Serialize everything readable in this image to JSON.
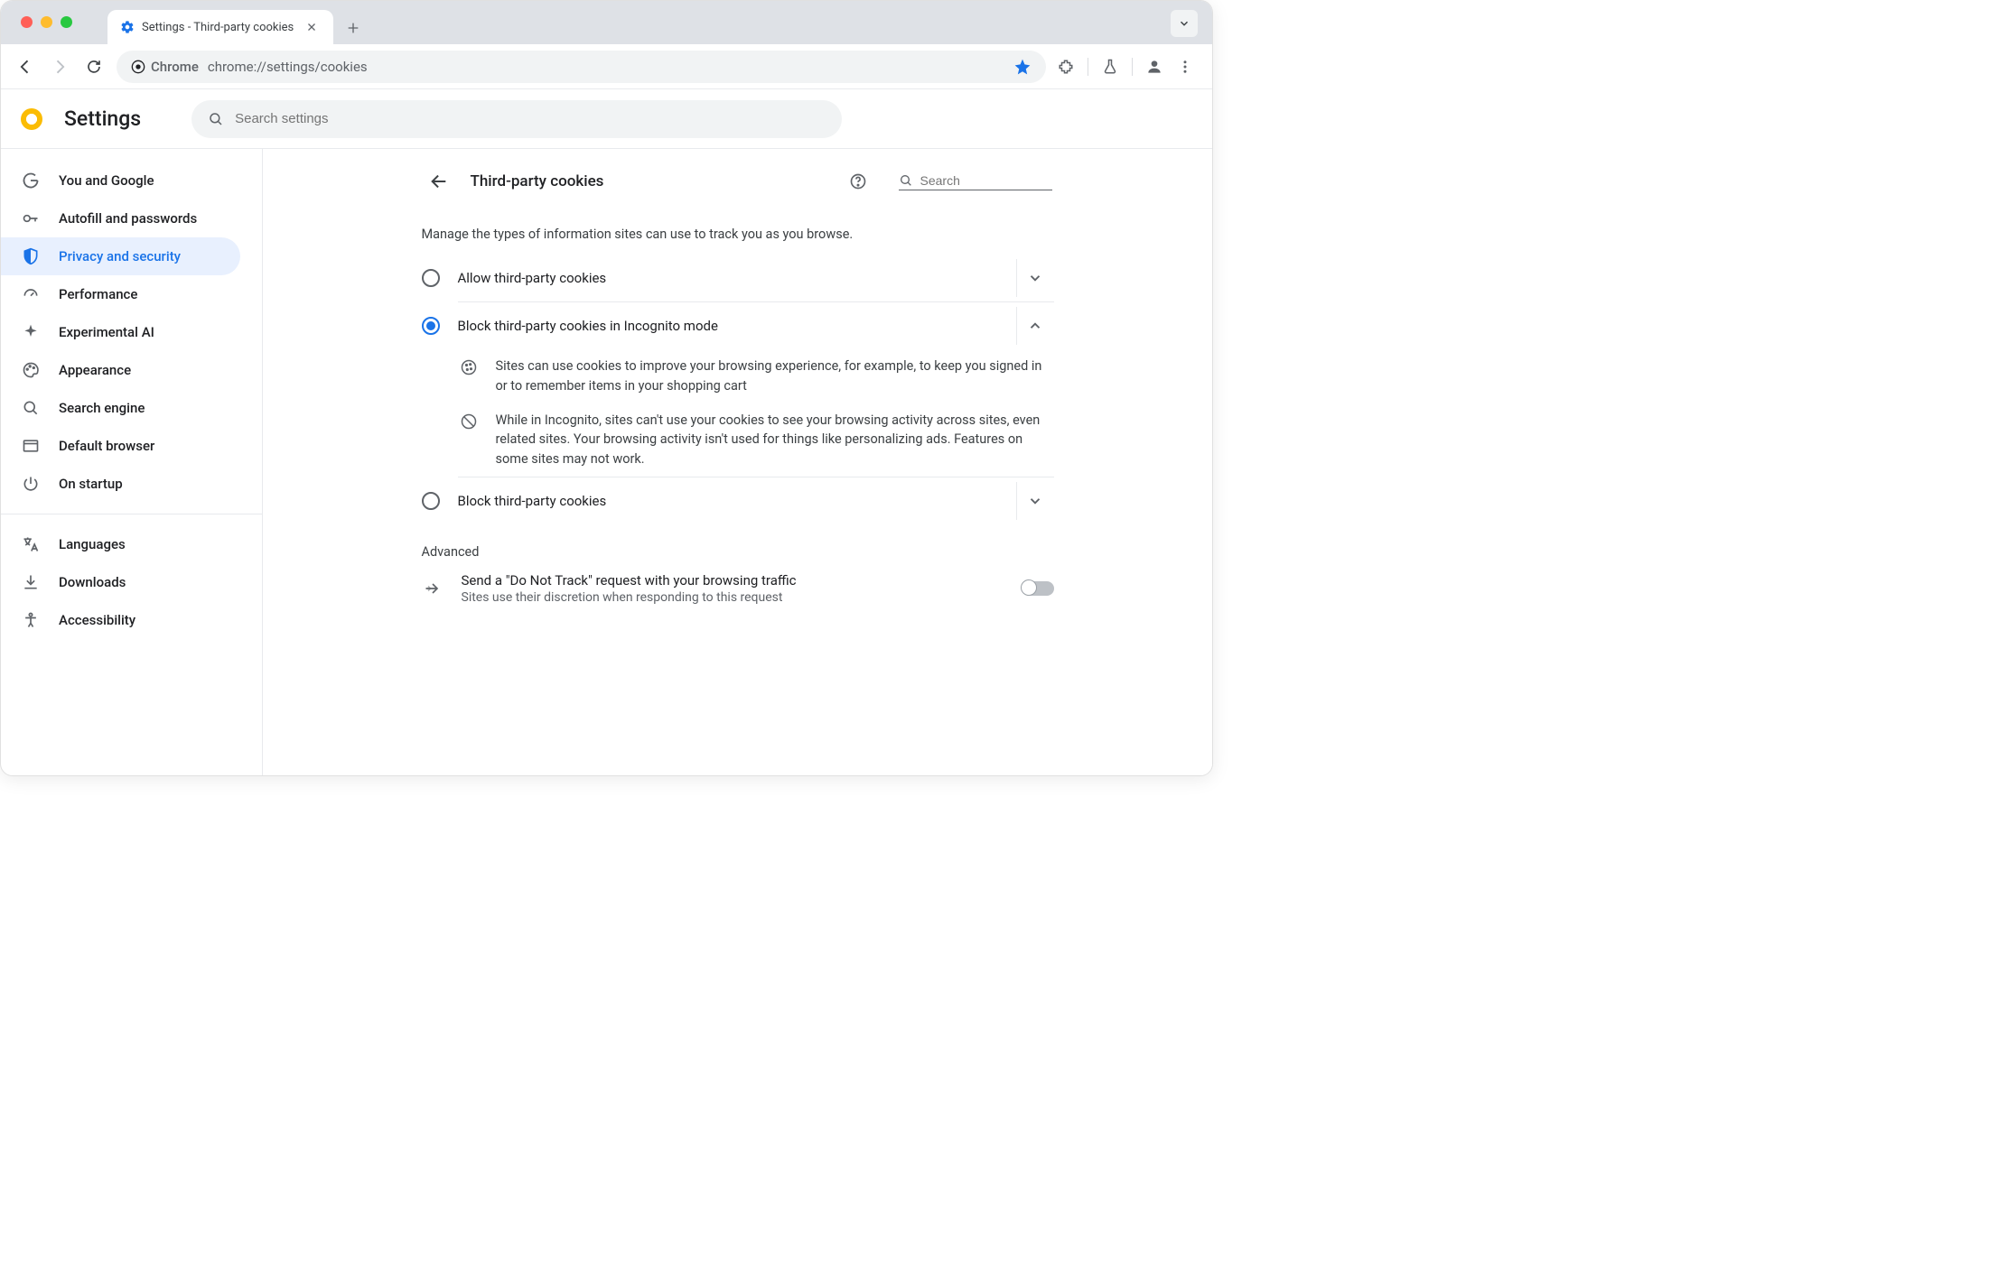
{
  "tab": {
    "title": "Settings - Third-party cookies"
  },
  "omnibox": {
    "label": "Chrome",
    "url": "chrome://settings/cookies"
  },
  "header": {
    "title": "Settings",
    "search_placeholder": "Search settings"
  },
  "sidebar": {
    "items": [
      {
        "label": "You and Google"
      },
      {
        "label": "Autofill and passwords"
      },
      {
        "label": "Privacy and security"
      },
      {
        "label": "Performance"
      },
      {
        "label": "Experimental AI"
      },
      {
        "label": "Appearance"
      },
      {
        "label": "Search engine"
      },
      {
        "label": "Default browser"
      },
      {
        "label": "On startup"
      }
    ],
    "items2": [
      {
        "label": "Languages"
      },
      {
        "label": "Downloads"
      },
      {
        "label": "Accessibility"
      }
    ]
  },
  "panel": {
    "title": "Third-party cookies",
    "search_placeholder": "Search",
    "description": "Manage the types of information sites can use to track you as you browse.",
    "options": [
      {
        "label": "Allow third-party cookies"
      },
      {
        "label": "Block third-party cookies in Incognito mode"
      },
      {
        "label": "Block third-party cookies"
      }
    ],
    "details": [
      "Sites can use cookies to improve your browsing experience, for example, to keep you signed in or to remember items in your shopping cart",
      "While in Incognito, sites can't use your cookies to see your browsing activity across sites, even related sites. Your browsing activity isn't used for things like personalizing ads. Features on some sites may not work."
    ],
    "advanced_label": "Advanced",
    "dnt": {
      "title": "Send a \"Do Not Track\" request with your browsing traffic",
      "sub": "Sites use their discretion when responding to this request"
    }
  }
}
